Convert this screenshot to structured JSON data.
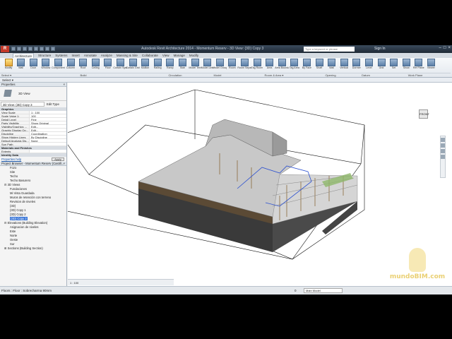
{
  "titlebar": {
    "app_letter": "R",
    "title": "Autodesk Revit Architecture 2014 - Momentum Reserv - 3D View: {3D} Copy 3",
    "search_placeholder": "Type a keyword or phrase",
    "sign_in": "Sign In"
  },
  "tabs": [
    "Architecture",
    "Structure",
    "Systems",
    "Insert",
    "Annotate",
    "Analyze",
    "Massing & Site",
    "Collaborate",
    "View",
    "Manage",
    "Modify"
  ],
  "ribbon": {
    "buttons": [
      "Modify",
      "Wall",
      "Door",
      "Window",
      "Component",
      "Column",
      "Roof",
      "Ceiling",
      "Floor",
      "Curtain System",
      "Curtain Grid",
      "Mullion",
      "Railing",
      "Ramp",
      "Stair",
      "Model Text",
      "Model Line",
      "Model Group",
      "Room",
      "Room Separator",
      "Tag Room",
      "Area",
      "Area Boundary",
      "Tag Area",
      "By Face",
      "Shaft",
      "Wall",
      "Vertical",
      "Dormer",
      "Level",
      "Grid",
      "Set",
      "Show",
      "Ref Plane",
      "Viewer"
    ],
    "panels": [
      "Select ▾",
      "Build",
      "Circulation",
      "Model",
      "Room & Area ▾",
      "Opening",
      "Datum",
      "Work Plane"
    ]
  },
  "select_label": "Select ▾",
  "properties": {
    "header": "Properties",
    "type_name": "3D View",
    "view_selector": "3D View: {3D} Copy 3",
    "edit_type": "Edit Type",
    "group_graphics": "Graphics",
    "rows": [
      {
        "k": "View Scale",
        "v": "1 : 100"
      },
      {
        "k": "Scale Value 1:",
        "v": "100"
      },
      {
        "k": "Detail Level",
        "v": "Fine"
      },
      {
        "k": "Parts Visibility",
        "v": "Show Original"
      },
      {
        "k": "Visibility/Graphics ...",
        "v": "Edit..."
      },
      {
        "k": "Graphic Display Op...",
        "v": "Edit..."
      },
      {
        "k": "Discipline",
        "v": "Coordination"
      },
      {
        "k": "Show Hidden Lines",
        "v": "By Discipline"
      },
      {
        "k": "Default Analysis Dis...",
        "v": "None"
      },
      {
        "k": "Sun Path",
        "v": ""
      }
    ],
    "group_extents": "Materials and Finishes",
    "extents_row": "Extents",
    "group_identity": "Identity Data",
    "help": "Properties help",
    "apply": "Apply"
  },
  "browser": {
    "header": "Project Browser - Momentum Reserv (Castill...",
    "items": [
      {
        "level": 2,
        "text": "Fozo"
      },
      {
        "level": 2,
        "text": "Site"
      },
      {
        "level": 2,
        "text": "Techo"
      },
      {
        "level": 2,
        "text": "Techo Basurero"
      },
      {
        "level": 1,
        "text": "⊟ 3D Views"
      },
      {
        "level": 2,
        "text": "Fundaciones"
      },
      {
        "level": 2,
        "text": "Mi Vista Guardada"
      },
      {
        "level": 2,
        "text": "Muros de retención con terreno"
      },
      {
        "level": 2,
        "text": "Revision de niveles"
      },
      {
        "level": 2,
        "text": "{3D}"
      },
      {
        "level": 2,
        "text": "{3D} Copy 1"
      },
      {
        "level": 2,
        "text": "{3D} Copy 2"
      },
      {
        "level": 2,
        "text": "{3D} Copy 3",
        "selected": true
      },
      {
        "level": 1,
        "text": "⊟ Elevations (Building Elevation)"
      },
      {
        "level": 2,
        "text": "Asignacion de niveles"
      },
      {
        "level": 2,
        "text": "Este"
      },
      {
        "level": 2,
        "text": "Norte"
      },
      {
        "level": 2,
        "text": "Oeste"
      },
      {
        "level": 2,
        "text": "Sur"
      },
      {
        "level": 1,
        "text": "⊞ Sections (Building Section)"
      }
    ]
  },
  "viewcube_label": "FRONT",
  "view_controls": "1 : 100",
  "status": {
    "text": "Floors : Floor : Sobrecharma 90mm",
    "zero": "0",
    "model": "Main Model"
  },
  "watermark": "mundoBIM.com"
}
